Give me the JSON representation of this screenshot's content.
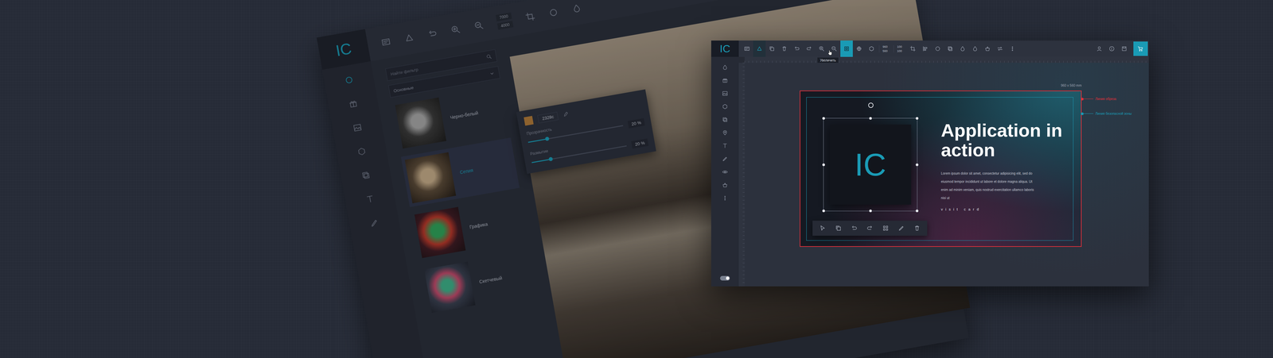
{
  "editorBack": {
    "logo": "IC",
    "tools": [
      {
        "selected": true
      },
      {
        "selected": false
      },
      {
        "selected": false
      },
      {
        "selected": false
      },
      {
        "selected": false
      },
      {
        "selected": false
      },
      {
        "selected": false
      }
    ],
    "toolbarFields": [
      "7000",
      "4000"
    ],
    "search": {
      "placeholder": "Найти фильтр"
    },
    "category": "Основные",
    "filters": [
      {
        "name": "Черно-белый",
        "selected": false
      },
      {
        "name": "Сепия",
        "selected": true
      },
      {
        "name": "Графика",
        "selected": false
      },
      {
        "name": "Скетчевый",
        "selected": false
      }
    ],
    "adjust": {
      "value": "2328с",
      "sliders": [
        {
          "label": "Прозрачность",
          "level": 0.2,
          "reading": "20 %"
        },
        {
          "label": "Размытие",
          "level": 0.2,
          "reading": "20 %"
        }
      ]
    }
  },
  "editorFront": {
    "logo": "IC",
    "tools": [
      {
        "selected": false
      },
      {
        "selected": true
      },
      {
        "selected": false
      },
      {
        "selected": false
      },
      {
        "selected": false
      },
      {
        "selected": false
      },
      {
        "selected": false
      },
      {
        "selected": false
      },
      {
        "selected": true
      },
      {
        "selected": false
      },
      {
        "selected": false
      }
    ],
    "fields": [
      {
        "top": "960",
        "bottom": "560"
      },
      {
        "top": "100",
        "bottom": "100"
      }
    ],
    "tools2": [
      {
        "selected": false
      },
      {
        "selected": false
      },
      {
        "selected": false
      },
      {
        "selected": false
      },
      {
        "selected": false
      },
      {
        "selected": false
      },
      {
        "selected": false
      },
      {
        "selected": false
      },
      {
        "selected": false
      }
    ],
    "tooltip": "Увеличить",
    "sidebarTools": [
      {
        "selected": false
      },
      {
        "selected": false
      },
      {
        "selected": false
      },
      {
        "selected": false
      },
      {
        "selected": false
      },
      {
        "selected": false
      },
      {
        "selected": false
      },
      {
        "selected": false
      },
      {
        "selected": false
      },
      {
        "selected": false
      },
      {
        "selected": false
      }
    ],
    "themeToggle": {
      "on": true
    },
    "size": "960 x 560 mm",
    "guides": [
      {
        "label": "Линия обреза",
        "color": "#e0303a"
      },
      {
        "label": "Линия безопасной зоны",
        "color": "#1a9bb5"
      }
    ],
    "card": {
      "logo": "IC",
      "title": "Application in action",
      "body": "Lorem ipsum dolor sit amet, consectetur adipisicing elit, sed do eiusmod tempor incididunt ut labore et dolore magna aliqua. Ut enim ad minim veniam, quis nostrud exercitation ullamco laboris nisi ut",
      "cta": "visit card"
    }
  }
}
